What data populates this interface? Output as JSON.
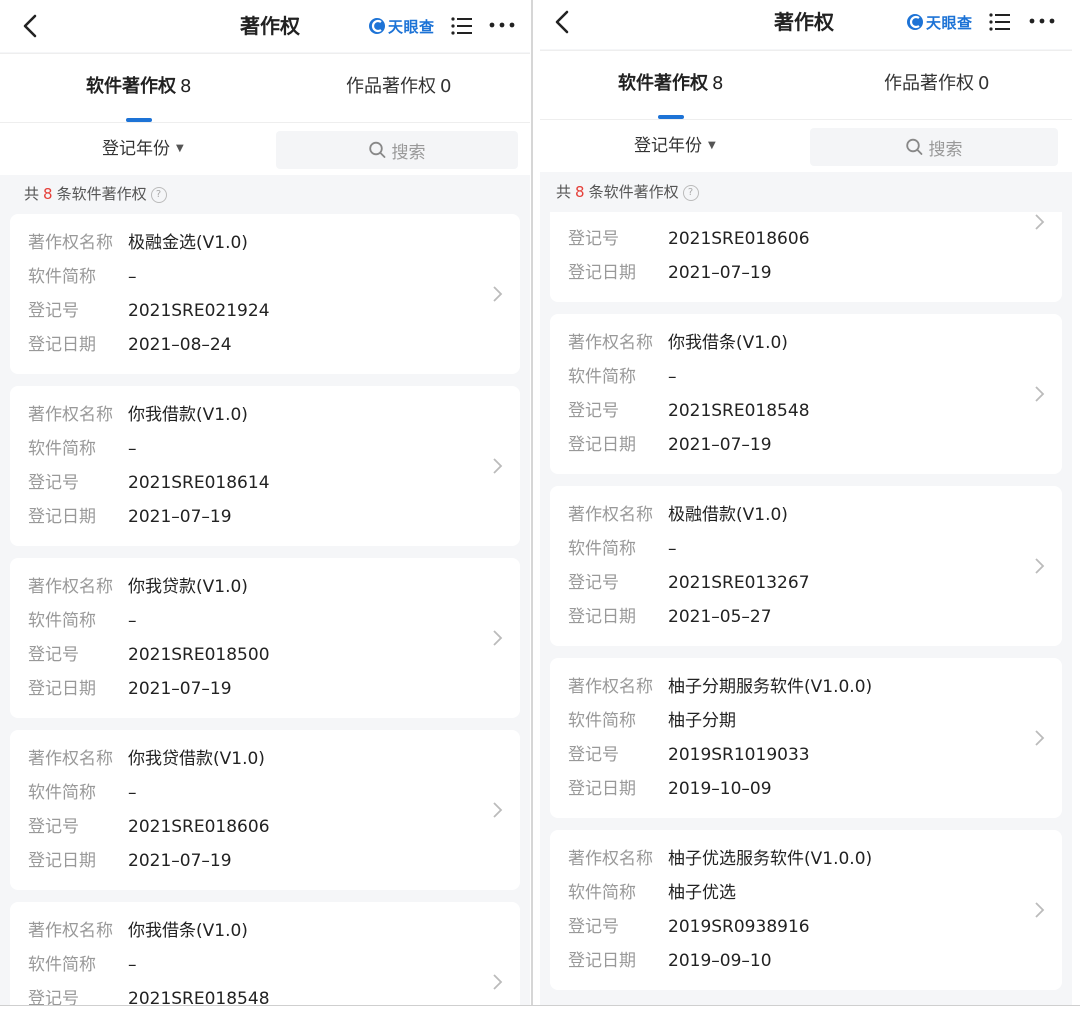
{
  "nav": {
    "title": "著作权",
    "brand": "天眼查"
  },
  "tabs": [
    {
      "label": "软件著作权",
      "count": "8"
    },
    {
      "label": "作品著作权",
      "count": "0"
    }
  ],
  "filter": {
    "year_label": "登记年份",
    "search_placeholder": "搜索"
  },
  "summary": {
    "prefix": "共",
    "count": "8",
    "suffix": "条软件著作权"
  },
  "labels": {
    "name": "著作权名称",
    "short": "软件简称",
    "reg_no": "登记号",
    "date": "登记日期"
  },
  "records": [
    {
      "name": "极融金选(V1.0)",
      "short": "–",
      "reg_no": "2021SRE021924",
      "date": "2021–08–24"
    },
    {
      "name": "你我借款(V1.0)",
      "short": "–",
      "reg_no": "2021SRE018614",
      "date": "2021–07–19"
    },
    {
      "name": "你我贷款(V1.0)",
      "short": "–",
      "reg_no": "2021SRE018500",
      "date": "2021–07–19"
    },
    {
      "name": "你我贷借款(V1.0)",
      "short": "–",
      "reg_no": "2021SRE018606",
      "date": "2021–07–19"
    },
    {
      "name": "你我借条(V1.0)",
      "short": "–",
      "reg_no": "2021SRE018548",
      "date": "2021–07–19"
    },
    {
      "name": "极融借款(V1.0)",
      "short": "–",
      "reg_no": "2021SRE013267",
      "date": "2021–05–27"
    },
    {
      "name": "柚子分期服务软件(V1.0.0)",
      "short": "柚子分期",
      "reg_no": "2019SR1019033",
      "date": "2019–10–09"
    },
    {
      "name": "柚子优选服务软件(V1.0.0)",
      "short": "柚子优选",
      "reg_no": "2019SR0938916",
      "date": "2019–09–10"
    }
  ],
  "colors": {
    "accent": "#1d73d6",
    "count_red": "#e5403a"
  }
}
